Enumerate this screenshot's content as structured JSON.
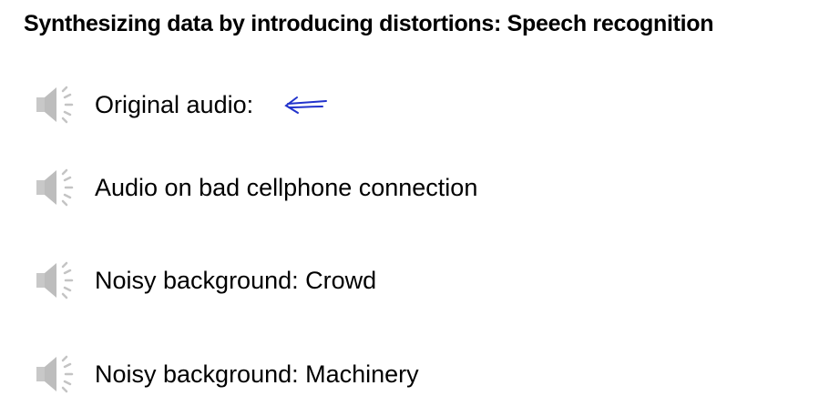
{
  "slide": {
    "title": "Synthesizing data by introducing distortions: Speech recognition",
    "items": [
      {
        "label": "Original audio:",
        "icon": "speaker-icon"
      },
      {
        "label": "Audio on bad cellphone connection",
        "icon": "speaker-icon"
      },
      {
        "label": "Noisy background: Crowd",
        "icon": "speaker-icon"
      },
      {
        "label": "Noisy background: Machinery",
        "icon": "speaker-icon"
      }
    ],
    "annotation_color": "#2233cc"
  }
}
